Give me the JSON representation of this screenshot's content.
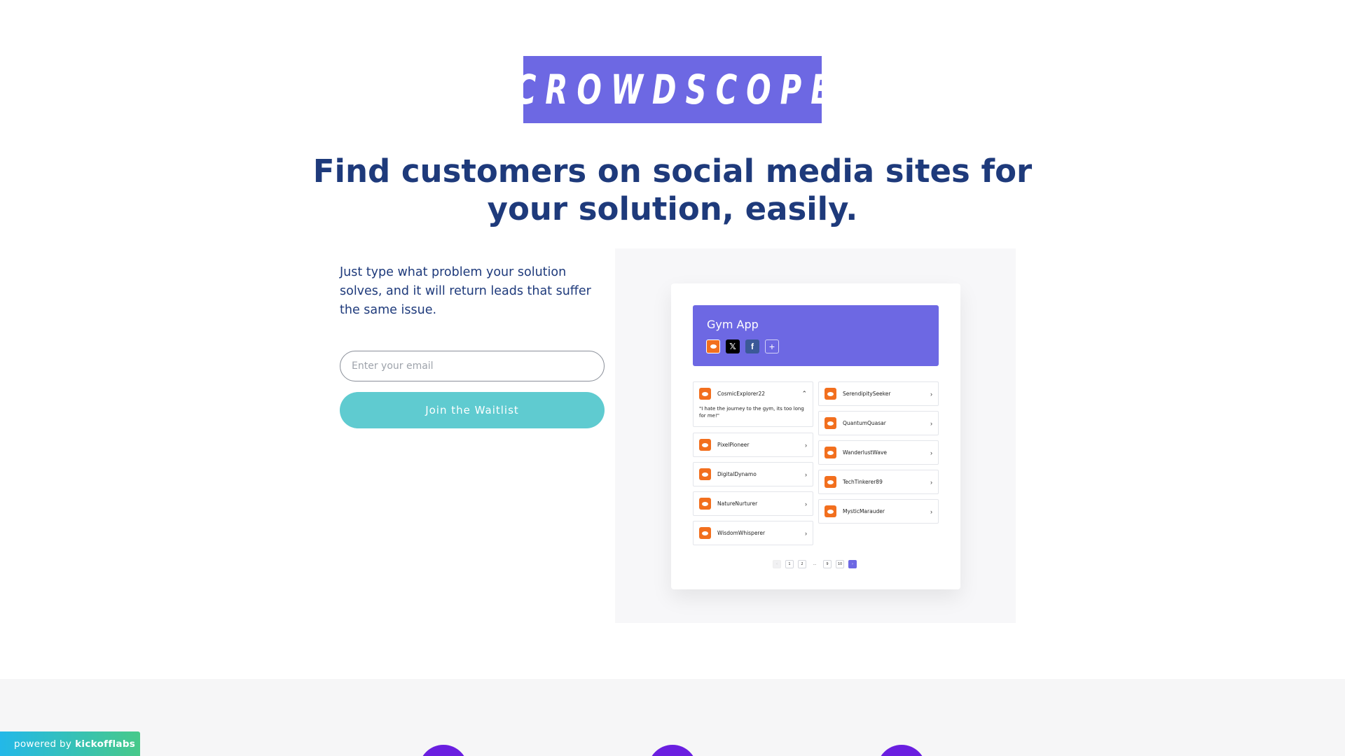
{
  "brand": {
    "logo_text": "CROWDSCOPE",
    "accent": "#6d68e3",
    "cta_color": "#5fcbd0",
    "text_color": "#1e3a7b"
  },
  "hero": {
    "headline": "Find customers on social media sites for your solution, easily.",
    "description": "Just type what problem your solution solves, and it will return leads that suffer the same issue."
  },
  "form": {
    "email_placeholder": "Enter your email",
    "submit_label": "Join the Waitlist"
  },
  "preview": {
    "title": "Gym App",
    "chips": [
      "reddit-icon",
      "x-icon",
      "facebook-icon",
      "plus-icon"
    ],
    "chip_glyphs": {
      "x": "𝕏",
      "fb": "f",
      "plus": "+"
    },
    "expanded_lead": {
      "name": "CosmicExplorer22",
      "quote": "\"I hate the journey to the gym, its too long for me!\"",
      "chevron": "⌃"
    },
    "left_leads": [
      "PixelPioneer",
      "DigitalDynamo",
      "NatureNurturer",
      "WisdomWhisperer"
    ],
    "right_leads": [
      "SerendipitySeeker",
      "QuantumQuasar",
      "WanderlustWave",
      "TechTinkerer89",
      "MysticMarauder"
    ],
    "lead_chevron": "›",
    "pager": [
      "‹",
      "1",
      "2",
      "…",
      "9",
      "10",
      "›"
    ]
  },
  "footer": {
    "powered_prefix": "powered by",
    "powered_brand": "kickofflabs"
  }
}
